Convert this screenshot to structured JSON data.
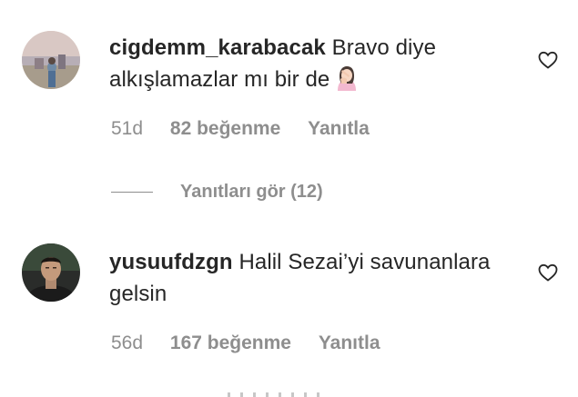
{
  "comments": [
    {
      "username": "cigdemm_karabacak",
      "text": "Bravo diye alkışlamazlar mı bir de",
      "emoji": "woman-facepalming-emoji",
      "time": "51d",
      "likes": "82 beğenme",
      "reply": "Yanıtla",
      "view_replies": "Yanıtları gör (12)"
    },
    {
      "username": "yusuufdzgn",
      "text": "Halil Sezai’yi savunanlara gelsin",
      "time": "56d",
      "likes": "167 beğenme",
      "reply": "Yanıtla"
    }
  ],
  "icons": {
    "like": "heart-outline-icon"
  },
  "colors": {
    "text": "#262626",
    "secondary": "#8e8e8e",
    "background": "#ffffff"
  }
}
